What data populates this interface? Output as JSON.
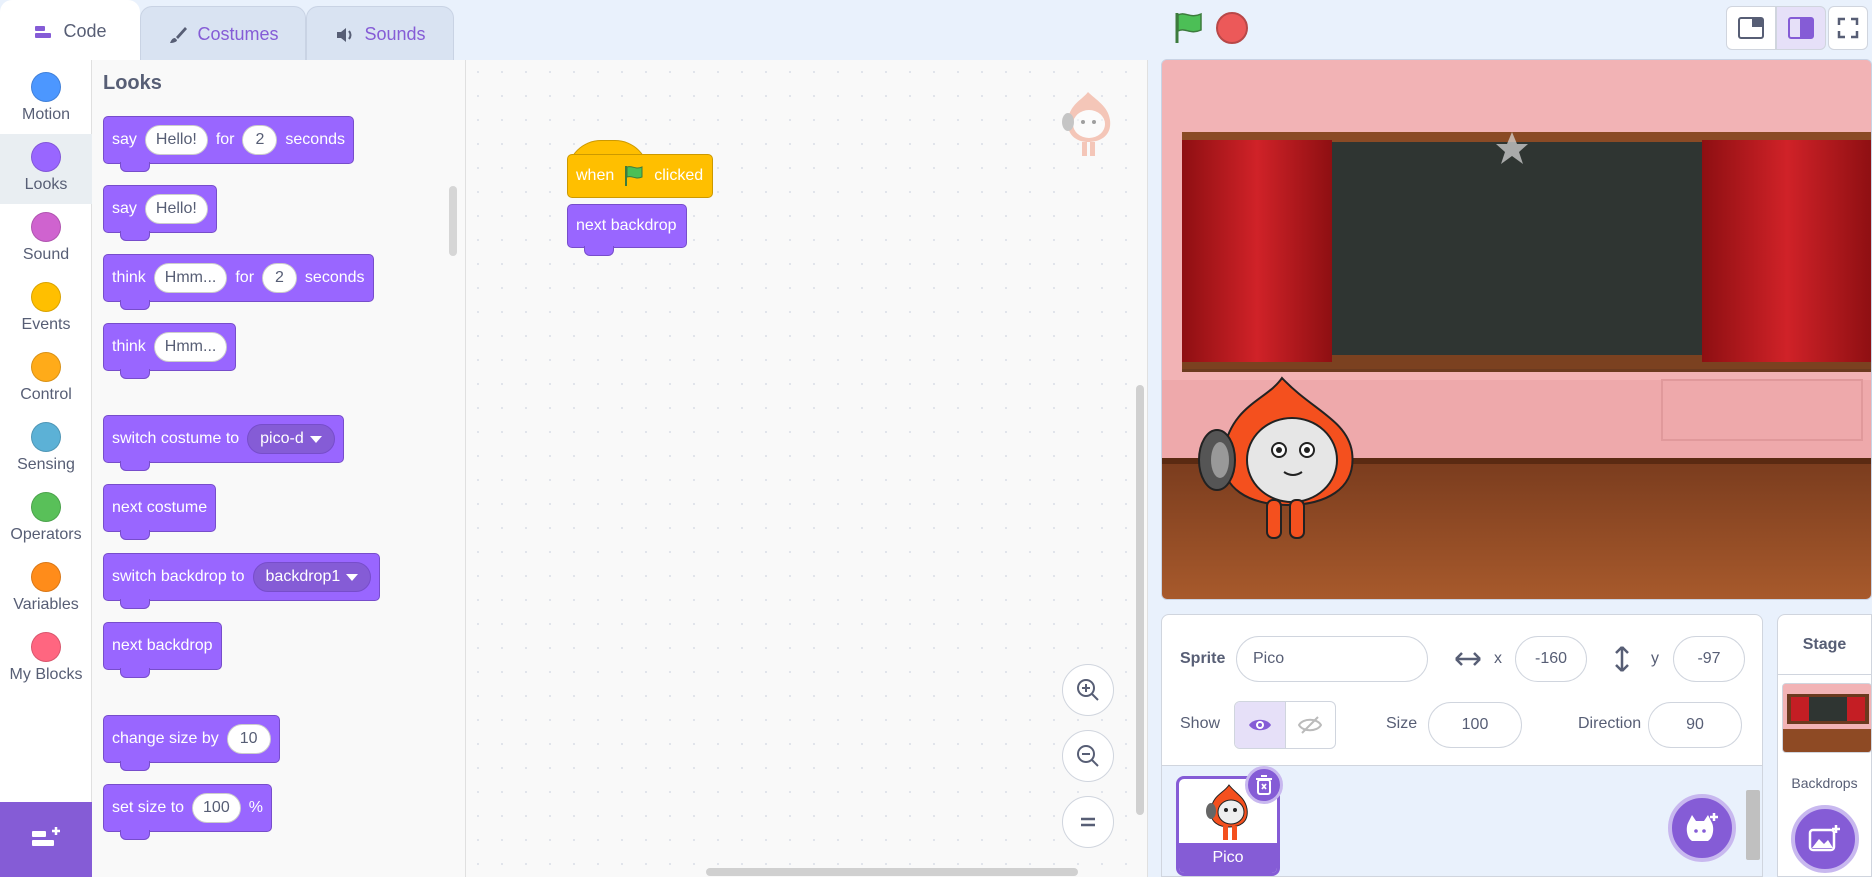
{
  "tabs": [
    {
      "label": "Code",
      "active": true
    },
    {
      "label": "Costumes",
      "active": false
    },
    {
      "label": "Sounds",
      "active": false
    }
  ],
  "categories": [
    {
      "label": "Motion",
      "color": "#4c97ff"
    },
    {
      "label": "Looks",
      "color": "#9966ff"
    },
    {
      "label": "Sound",
      "color": "#cf63cf"
    },
    {
      "label": "Events",
      "color": "#ffbf00"
    },
    {
      "label": "Control",
      "color": "#ffab19"
    },
    {
      "label": "Sensing",
      "color": "#5cb1d6"
    },
    {
      "label": "Operators",
      "color": "#59c059"
    },
    {
      "label": "Variables",
      "color": "#ff8c1a"
    },
    {
      "label": "My Blocks",
      "color": "#ff6680"
    }
  ],
  "palette": {
    "title": "Looks",
    "say_for": {
      "word": "say",
      "msg": "Hello!",
      "for": "for",
      "secs": "2",
      "unit": "seconds"
    },
    "say": {
      "word": "say",
      "msg": "Hello!"
    },
    "think_for": {
      "word": "think",
      "msg": "Hmm...",
      "for": "for",
      "secs": "2",
      "unit": "seconds"
    },
    "think": {
      "word": "think",
      "msg": "Hmm..."
    },
    "switch_costume": {
      "text": "switch costume to",
      "value": "pico-d"
    },
    "next_costume": "next costume",
    "switch_backdrop": {
      "text": "switch backdrop to",
      "value": "backdrop1"
    },
    "next_backdrop": "next backdrop",
    "change_size": {
      "text": "change size by",
      "value": "10"
    },
    "set_size": {
      "text": "set size to",
      "value": "100",
      "unit": "%"
    }
  },
  "script": {
    "hat_when": "when",
    "hat_clicked": "clicked",
    "next_backdrop": "next backdrop"
  },
  "sprite_info": {
    "sprite_label": "Sprite",
    "sprite_name": "Pico",
    "x_label": "x",
    "x_value": "-160",
    "y_label": "y",
    "y_value": "-97",
    "show_label": "Show",
    "size_label": "Size",
    "size_value": "100",
    "direction_label": "Direction",
    "direction_value": "90"
  },
  "sprites": [
    {
      "name": "Pico",
      "selected": true
    }
  ],
  "stage_panel": {
    "title": "Stage",
    "backdrops_label": "Backdrops"
  },
  "colors": {
    "accent": "#855cd6",
    "looks": "#9966ff",
    "events": "#ffbf00"
  }
}
